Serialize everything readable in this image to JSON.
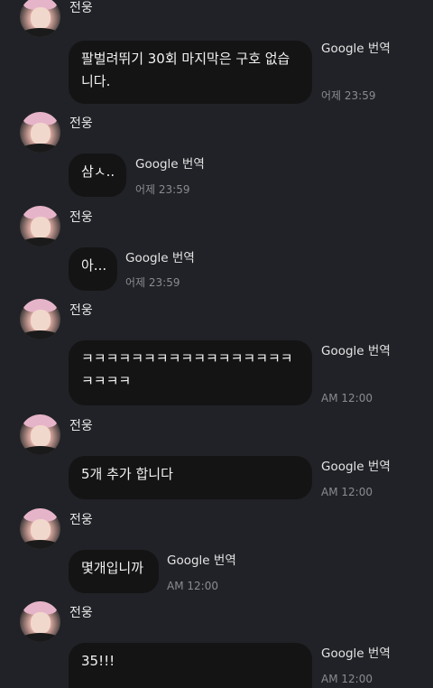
{
  "translate_label": "Google 번역",
  "messages": [
    {
      "sender": "전웅",
      "text": "팔벌려뛰기 30회 마지막은 구호 없습\n니다.",
      "time": "어제 23:59"
    },
    {
      "sender": "전웅",
      "text": "삼ㅅ..",
      "time": "어제 23:59"
    },
    {
      "sender": "전웅",
      "text": "아...",
      "time": "어제 23:59"
    },
    {
      "sender": "전웅",
      "text": "ㅋㅋㅋㅋㅋㅋㅋㅋㅋㅋㅋㅋㅋㅋㅋㅋㅋ\nㅋㅋㅋㅋ",
      "time": "AM 12:00"
    },
    {
      "sender": "전웅",
      "text": "5개 추가 합니다",
      "time": "AM 12:00"
    },
    {
      "sender": "전웅",
      "text": "몇개입니까",
      "time": "AM 12:00"
    },
    {
      "sender": "전웅",
      "text": "35!!!",
      "time": "AM 12:00"
    }
  ]
}
